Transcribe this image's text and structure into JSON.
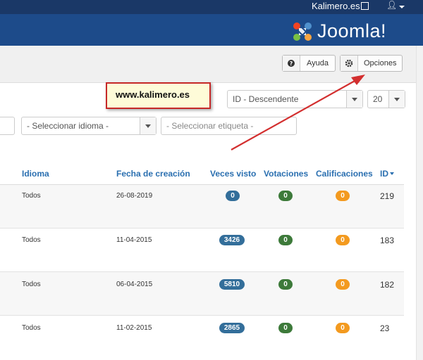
{
  "topbar": {
    "site_label": "Kalimero.es",
    "user_icon": "user-icon"
  },
  "header": {
    "logo_text": "Joomla!"
  },
  "toolbar": {
    "help_label": "Ayuda",
    "options_label": "Opciones"
  },
  "callout": {
    "text": "www.kalimero.es"
  },
  "filters": {
    "ordering": "ID - Descendente",
    "limit": "20",
    "language": "- Seleccionar idioma -",
    "tag_placeholder": "- Seleccionar etiqueta -"
  },
  "table": {
    "headers": {
      "language": "Idioma",
      "created": "Fecha de creación",
      "hits": "Veces visto",
      "votes": "Votaciones",
      "ratings": "Calificaciones",
      "id": "ID"
    },
    "rows": [
      {
        "language": "Todos",
        "created": "26-08-2019",
        "hits": "0",
        "votes": "0",
        "ratings": "0",
        "id": "219"
      },
      {
        "language": "Todos",
        "created": "11-04-2015",
        "hits": "3426",
        "votes": "0",
        "ratings": "0",
        "id": "183"
      },
      {
        "language": "Todos",
        "created": "06-04-2015",
        "hits": "5810",
        "votes": "0",
        "ratings": "0",
        "id": "182"
      },
      {
        "language": "Todos",
        "created": "11-02-2015",
        "hits": "2865",
        "votes": "0",
        "ratings": "0",
        "id": "23"
      }
    ]
  },
  "colors": {
    "topbar": "#1a3867",
    "header": "#1d4b8a",
    "link": "#2a6fb0",
    "hits_badge": "#336e9a",
    "votes_badge": "#3d7a3a",
    "ratings_badge": "#f39a1f",
    "callout_border": "#c62828"
  }
}
